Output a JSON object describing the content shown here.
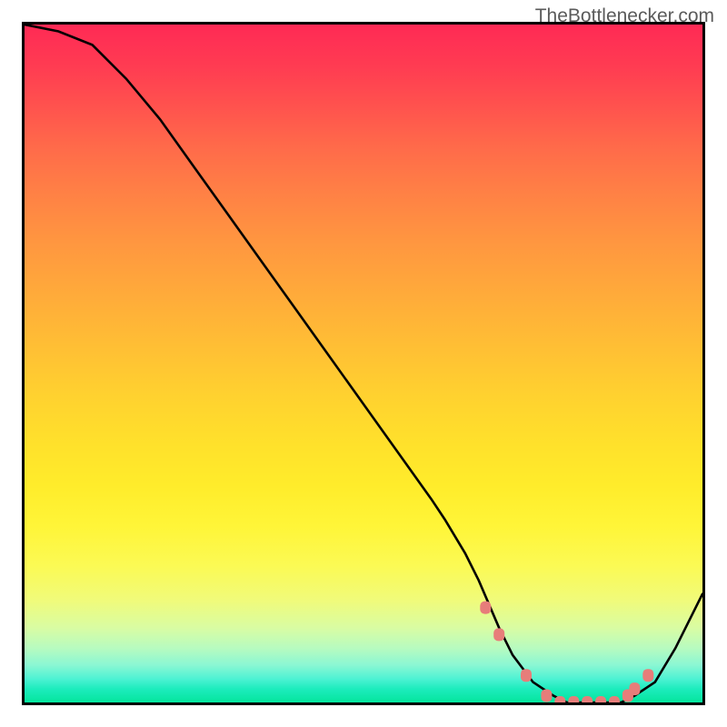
{
  "watermark": "TheBottlenecker.com",
  "chart_data": {
    "type": "line",
    "title": "",
    "xlabel": "",
    "ylabel": "",
    "x": [
      0,
      5,
      10,
      15,
      20,
      25,
      30,
      35,
      40,
      45,
      50,
      55,
      60,
      62,
      65,
      67,
      70,
      72,
      75,
      78,
      80,
      82,
      85,
      88,
      90,
      93,
      96,
      100
    ],
    "values": [
      100,
      99,
      97,
      92,
      86,
      79,
      72,
      65,
      58,
      51,
      44,
      37,
      30,
      27,
      22,
      18,
      11,
      7,
      3,
      1,
      0,
      0,
      0,
      0,
      1,
      3,
      8,
      16
    ],
    "markers_x": [
      68,
      70,
      74,
      77,
      79,
      81,
      83,
      85,
      87,
      89,
      90,
      92
    ],
    "markers_y": [
      14,
      10,
      4,
      1,
      0,
      0,
      0,
      0,
      0,
      1,
      2,
      4
    ],
    "xlim": [
      0,
      100
    ],
    "ylim": [
      0,
      100
    ],
    "background": "red-yellow-green vertical gradient",
    "marker_color": "#e77d7a",
    "line_color": "#000000"
  }
}
